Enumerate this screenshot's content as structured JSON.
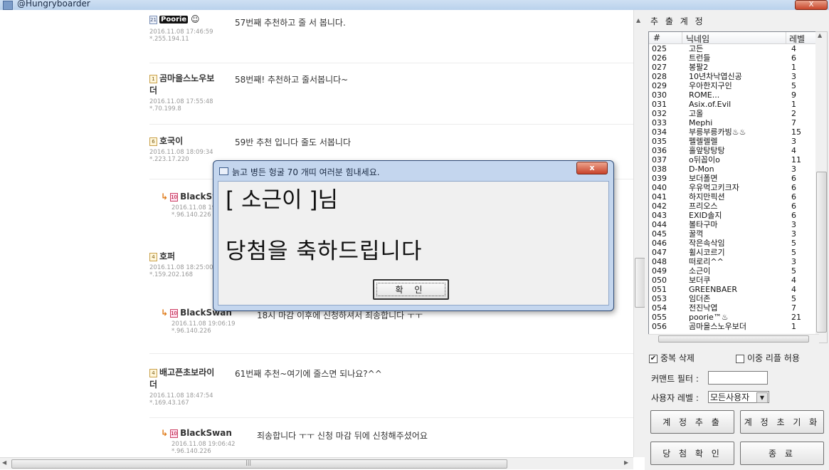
{
  "window": {
    "title": "@Hungryboarder",
    "close_label": "X"
  },
  "comments": [
    {
      "badge": "21",
      "nick": "Poorie",
      "date": "2016.11.08 17:46:59",
      "ip": "*.255.194.11",
      "text": "57번째 추천하고 줄 서 봅니다."
    },
    {
      "badge": "1",
      "nick": "곰마을스노우보",
      "nick2": "더",
      "date": "2016.11.08 17:55:48",
      "ip": "*.70.199.8",
      "text": "58번째! 추천하고 줄서봅니다~"
    },
    {
      "badge": "6",
      "nick": "호국이",
      "date": "2016.11.08 18:09:34",
      "ip": "*.223.17.220",
      "text": "59반 추천 입니다 줄도 서봅니다"
    },
    {
      "badge": "10",
      "nick": "BlackSwan",
      "date": "2016.11.08 19",
      "ip": "*.96.140.226",
      "text": ""
    },
    {
      "badge": "4",
      "nick": "호퍼",
      "date": "2016.11.08 18:25:00",
      "ip": "*.159.202.168",
      "text": ""
    },
    {
      "badge": "10",
      "nick": "BlackSwan",
      "date": "2016.11.08 19:06:19",
      "ip": "*.96.140.226",
      "text": "18시 마감 이후에 신청하셔서 죄송합니다 ㅜㅜ"
    },
    {
      "badge": "4",
      "nick": "배고픈초보라이",
      "nick2": "더",
      "date": "2016.11.08 18:47:54",
      "ip": "*.169.43.167",
      "text": "61번째 추천~여기에 줄스면 되나요?^^"
    },
    {
      "badge": "10",
      "nick": "BlackSwan",
      "date": "2016.11.08 19:06:42",
      "ip": "*.96.140.226",
      "text": "죄송합니다 ㅜㅜ 신청 마감 뒤에 신청해주셨어요"
    }
  ],
  "panel": {
    "title": "추 출 계 정",
    "columns": {
      "num": "#",
      "nick": "닉네임",
      "level": "레벨"
    },
    "rows": [
      {
        "num": "025",
        "nick": "고든",
        "level": "4"
      },
      {
        "num": "026",
        "nick": "트런들",
        "level": "6"
      },
      {
        "num": "027",
        "nick": "봉팔2",
        "level": "1"
      },
      {
        "num": "028",
        "nick": "10년차낙엽신공",
        "level": "3"
      },
      {
        "num": "029",
        "nick": "우아한지구인",
        "level": "5"
      },
      {
        "num": "030",
        "nick": "ROME...",
        "level": "9"
      },
      {
        "num": "031",
        "nick": "Asix.of.Evil",
        "level": "1"
      },
      {
        "num": "032",
        "nick": "고올",
        "level": "2"
      },
      {
        "num": "033",
        "nick": "Mephi",
        "level": "7"
      },
      {
        "num": "034",
        "nick": "부릉부릉카빙♨♨",
        "level": "15"
      },
      {
        "num": "035",
        "nick": "펠렐렐렐",
        "level": "3"
      },
      {
        "num": "036",
        "nick": "홀앞탕탕탕",
        "level": "4"
      },
      {
        "num": "037",
        "nick": "o뒤꼽이o",
        "level": "11"
      },
      {
        "num": "038",
        "nick": "D-Mon",
        "level": "3"
      },
      {
        "num": "039",
        "nick": "보더폴면",
        "level": "6"
      },
      {
        "num": "040",
        "nick": "우유먹고키크자",
        "level": "6"
      },
      {
        "num": "041",
        "nick": "하지만픽션",
        "level": "6"
      },
      {
        "num": "042",
        "nick": "프리오스",
        "level": "6"
      },
      {
        "num": "043",
        "nick": "EXID솔지",
        "level": "6"
      },
      {
        "num": "044",
        "nick": "볼타구마",
        "level": "3"
      },
      {
        "num": "045",
        "nick": "꿀꺽",
        "level": "3"
      },
      {
        "num": "046",
        "nick": "작은속삭임",
        "level": "5"
      },
      {
        "num": "047",
        "nick": "휠시코르기",
        "level": "5"
      },
      {
        "num": "048",
        "nick": "떠로리^^",
        "level": "3"
      },
      {
        "num": "049",
        "nick": "소근이",
        "level": "5"
      },
      {
        "num": "050",
        "nick": "보더쿠",
        "level": "4"
      },
      {
        "num": "051",
        "nick": "GREENBAER",
        "level": "4"
      },
      {
        "num": "053",
        "nick": "임더존",
        "level": "5"
      },
      {
        "num": "054",
        "nick": "전진낙엽",
        "level": "7"
      },
      {
        "num": "055",
        "nick": "poorie™♨",
        "level": "21"
      },
      {
        "num": "056",
        "nick": "곰마을스노우보더",
        "level": "1"
      }
    ],
    "chk_dup_label": "중복 삭제",
    "chk_dup_checked": "✔",
    "chk_double_label": "이중 리플 허용",
    "filter_label": "커맨트 필터 :",
    "filter_value": "",
    "level_label": "사용자 레벨 :",
    "level_value": "모든사용자",
    "btn_extract": "계 정 추 출",
    "btn_reset": "계 정 초 기 화",
    "btn_confirm": "당 첨 확 인",
    "btn_exit": "종 료"
  },
  "modal": {
    "title": "늙고 병든 헝굴 70 개띠 여러분 힘내세요.",
    "close_label": "x",
    "line1": "[ 소근이 ]님",
    "line2": "당첨을 축하드립니다",
    "ok_label": "확 인"
  }
}
